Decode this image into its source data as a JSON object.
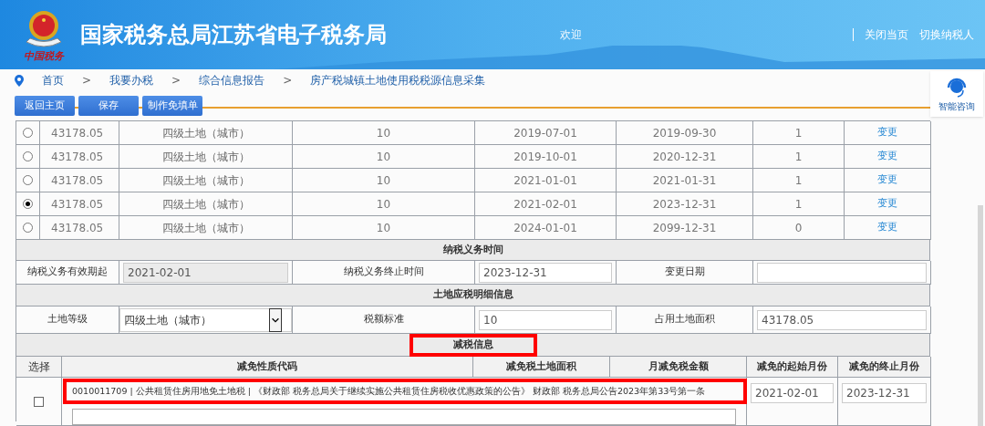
{
  "header": {
    "emblem_caption": "中国税务",
    "title": "国家税务总局江苏省电子税务局",
    "welcome": "欢迎",
    "links": [
      "关闭当页",
      "切换纳税人"
    ]
  },
  "breadcrumb": {
    "separator": ">",
    "items": [
      "首页",
      "我要办税",
      "综合信息报告",
      "房产税城镇土地使用税税源信息采集"
    ]
  },
  "toolbar": [
    "返回主页",
    "保存",
    "制作免填单"
  ],
  "help": {
    "label": "智能咨询"
  },
  "source_rows": [
    {
      "selected": false,
      "area": "43178.05",
      "grade": "四级土地（城市）",
      "rate": "10",
      "start": "2019-07-01",
      "end": "2019-09-30",
      "count": "1",
      "action": "变更"
    },
    {
      "selected": false,
      "area": "43178.05",
      "grade": "四级土地（城市）",
      "rate": "10",
      "start": "2019-10-01",
      "end": "2020-12-31",
      "count": "1",
      "action": "变更"
    },
    {
      "selected": false,
      "area": "43178.05",
      "grade": "四级土地（城市）",
      "rate": "10",
      "start": "2021-01-01",
      "end": "2021-01-31",
      "count": "1",
      "action": "变更"
    },
    {
      "selected": true,
      "area": "43178.05",
      "grade": "四级土地（城市）",
      "rate": "10",
      "start": "2021-02-01",
      "end": "2023-12-31",
      "count": "1",
      "action": "变更"
    },
    {
      "selected": false,
      "area": "43178.05",
      "grade": "四级土地（城市）",
      "rate": "10",
      "start": "2024-01-01",
      "end": "2099-12-31",
      "count": "0",
      "action": "变更"
    }
  ],
  "obligation": {
    "title": "纳税义务时间",
    "fields": [
      {
        "label": "纳税义务有效期起",
        "value": "2021-02-01",
        "disabled": true
      },
      {
        "label": "纳税义务终止时间",
        "value": "2023-12-31",
        "disabled": false
      },
      {
        "label": "变更日期",
        "disabled": false
      }
    ]
  },
  "land_detail": {
    "title": "土地应税明细信息",
    "fields": [
      {
        "kind": "select",
        "label": "土地等级",
        "value": "四级土地（城市）"
      },
      {
        "kind": "input",
        "label": "税额标准",
        "value": "10"
      },
      {
        "kind": "input",
        "label": "占用土地面积",
        "value": "43178.05"
      }
    ]
  },
  "relief": {
    "title": "减税信息",
    "columns": [
      "选择",
      "减免性质代码",
      "减免税土地面积",
      "月减免税金额",
      "减免的起始月份",
      "减免的终止月份"
    ],
    "rows": [
      {
        "checked": false,
        "code": "0010011709 | 公共租赁住房用地免土地税 | 《财政部 税务总局关于继续实施公共租赁住房税收优惠政策的公告》 财政部 税务总局公告2023年第33号第一条",
        "start": "2021-02-01",
        "end": "2023-12-31"
      }
    ]
  }
}
